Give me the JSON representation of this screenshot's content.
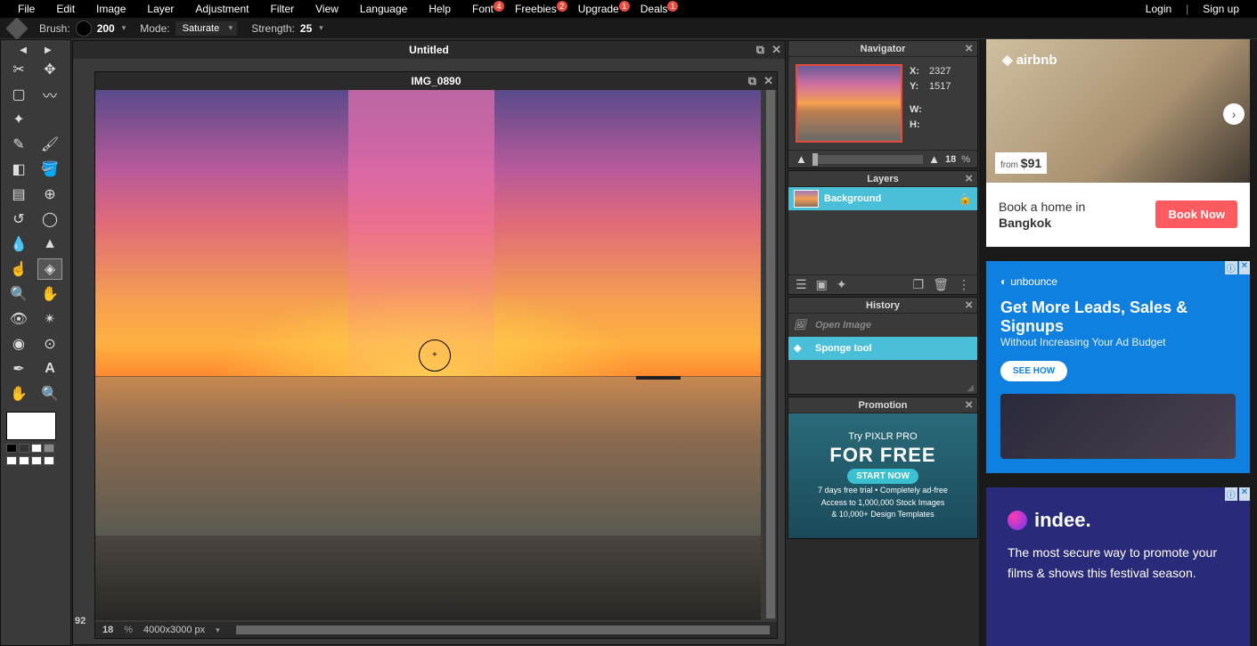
{
  "menu": {
    "items": [
      "File",
      "Edit",
      "Image",
      "Layer",
      "Adjustment",
      "Filter",
      "View",
      "Language",
      "Help",
      "Font",
      "Freebies",
      "Upgrade",
      "Deals"
    ],
    "badges": {
      "Font": "4",
      "Freebies": "2",
      "Upgrade": "1",
      "Deals": "1"
    },
    "login": "Login",
    "signup": "Sign up"
  },
  "toolbar": {
    "brush_label": "Brush:",
    "brush_size": "200",
    "mode_label": "Mode:",
    "mode_value": "Saturate",
    "strength_label": "Strength:",
    "strength_value": "25"
  },
  "window": {
    "outer_title": "Untitled",
    "inner_title": "IMG_0890",
    "left_ruler": "92",
    "zoom": "18",
    "zoom_unit": "%",
    "dims": "4000x3000 px"
  },
  "navigator": {
    "title": "Navigator",
    "x_label": "X:",
    "x_value": "2327",
    "y_label": "Y:",
    "y_value": "1517",
    "w_label": "W:",
    "h_label": "H:",
    "zoom": "18",
    "zoom_unit": "%"
  },
  "layers": {
    "title": "Layers",
    "items": [
      {
        "name": "Background",
        "locked": true
      }
    ]
  },
  "history": {
    "title": "History",
    "items": [
      {
        "label": "Open Image",
        "state": "dim"
      },
      {
        "label": "Sponge tool",
        "state": "selected"
      }
    ]
  },
  "promotion": {
    "title": "Promotion",
    "try": "Try PIXLR PRO",
    "free": "FOR FREE",
    "cta": "START NOW",
    "fine1": "7 days free trial • Completely ad-free",
    "fine2": "Access to 1,000,000 Stock Images",
    "fine3": "& 10,000+ Design Templates"
  },
  "ads": {
    "airbnb": {
      "logo": "airbnb",
      "price_prefix": "from",
      "price": "$91",
      "copy1": "Book a home in",
      "copy2": "Bangkok",
      "cta": "Book Now"
    },
    "unbounce": {
      "logo": "unbounce",
      "headline": "Get More Leads, Sales & Signups",
      "sub": "Without Increasing Your Ad Budget",
      "cta": "SEE HOW"
    },
    "indee": {
      "logo": "indee.",
      "copy": "The most secure way to promote your films & shows this festival season."
    }
  }
}
